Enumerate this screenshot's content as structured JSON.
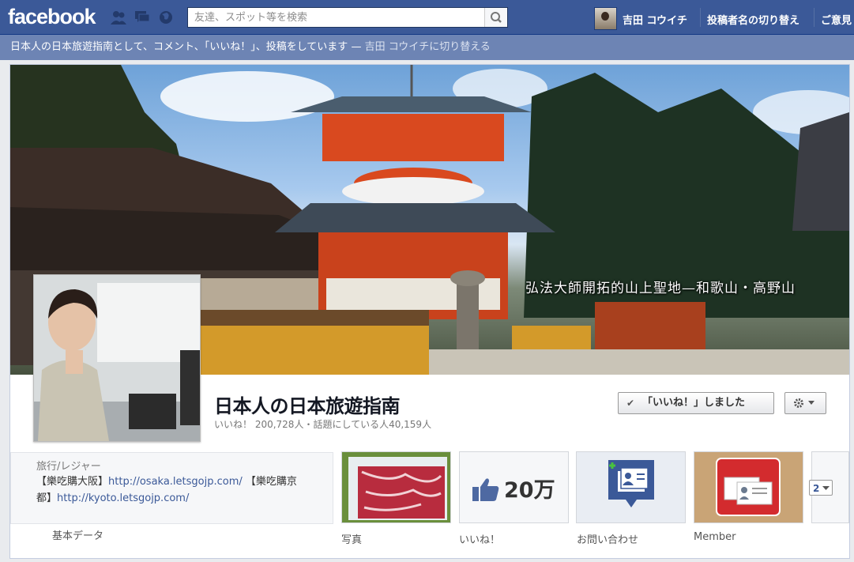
{
  "topbar": {
    "logo": "facebook",
    "search_placeholder": "友達、スポット等を検索",
    "user_name": "吉田 コウイチ",
    "switch_label": "投稿者名の切り替え",
    "feedback_label": "ご意見"
  },
  "notice": {
    "text": "日本人の日本旅遊指南として、コメント、「いいね！」、投稿をしています — ",
    "link": "吉田 コウイチに切り替える"
  },
  "cover": {
    "caption": "弘法大師開拓的山上聖地—和歌山・高野山"
  },
  "page": {
    "name": "日本人の日本旅遊指南",
    "stats": "いいね！ 200,728人・話題にしている人40,159人",
    "liked_button": "「いいね！」しました"
  },
  "about": {
    "category": "旅行/レジャー",
    "line1_prefix": "【樂吃購大阪】",
    "line1_url": "http://osaka.letsgojp.com/",
    "line1_suffix": " 【樂吃購京",
    "line2_prefix": "都】",
    "line2_url": "http://kyoto.letsgojp.com/",
    "basic_data": "基本データ"
  },
  "apps": [
    {
      "label": "写真"
    },
    {
      "label": "いいね！",
      "count": "20万"
    },
    {
      "label": "お問い合わせ"
    },
    {
      "label": "Member"
    }
  ],
  "more_count": "2",
  "colors": {
    "brand": "#3b5998",
    "notice_bar": "#6d84b4"
  }
}
